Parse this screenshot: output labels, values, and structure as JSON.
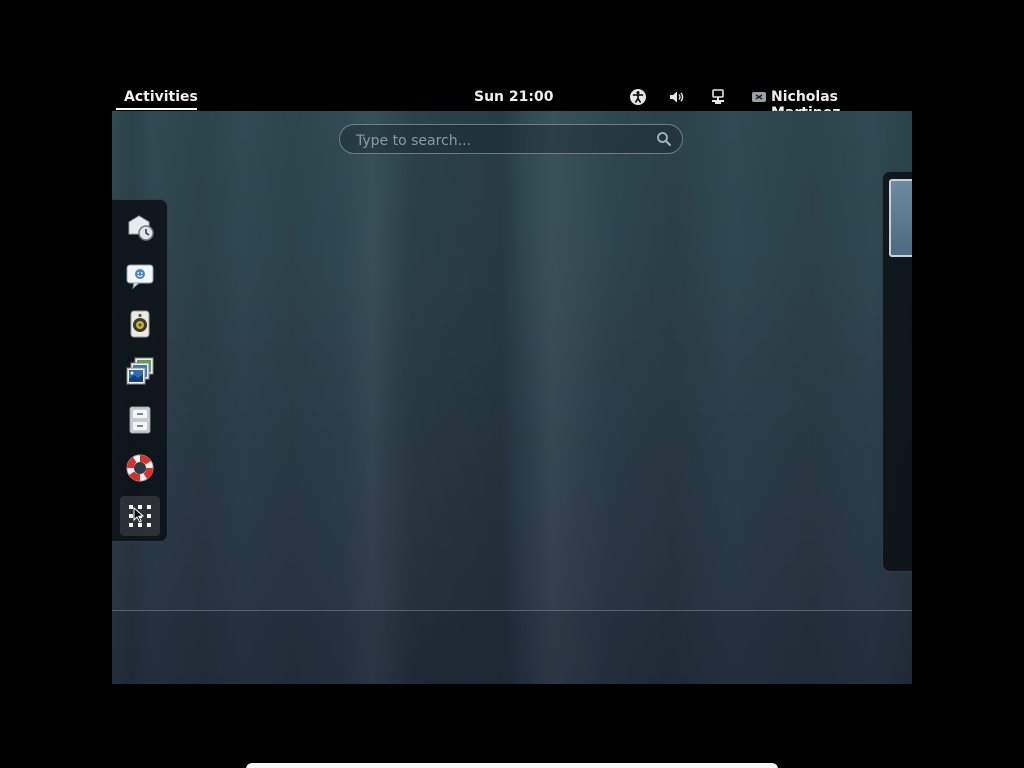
{
  "topbar": {
    "activities_label": "Activities",
    "clock": "Sun 21:00",
    "user_name": "Nicholas Martinez",
    "tray_icons": [
      "accessibility-icon",
      "volume-icon",
      "network-wired-icon",
      "user-offline-icon"
    ]
  },
  "search": {
    "placeholder": "Type to search...",
    "value": ""
  },
  "dash": {
    "items": [
      {
        "name": "dash-item-evolution",
        "icon": "mail-clock-icon"
      },
      {
        "name": "dash-item-empathy",
        "icon": "chat-bubble-icon"
      },
      {
        "name": "dash-item-rhythmbox",
        "icon": "speaker-icon"
      },
      {
        "name": "dash-item-shotwell",
        "icon": "photos-icon"
      },
      {
        "name": "dash-item-files",
        "icon": "file-cabinet-icon"
      },
      {
        "name": "dash-item-help",
        "icon": "lifebuoy-icon"
      },
      {
        "name": "dash-show-applications",
        "icon": "app-grid-icon"
      }
    ]
  },
  "colors": {
    "topbar_bg": "#000000",
    "overview_bg": "#2e464f",
    "dash_bg": "#0a0e12",
    "text": "#eeeeee"
  }
}
